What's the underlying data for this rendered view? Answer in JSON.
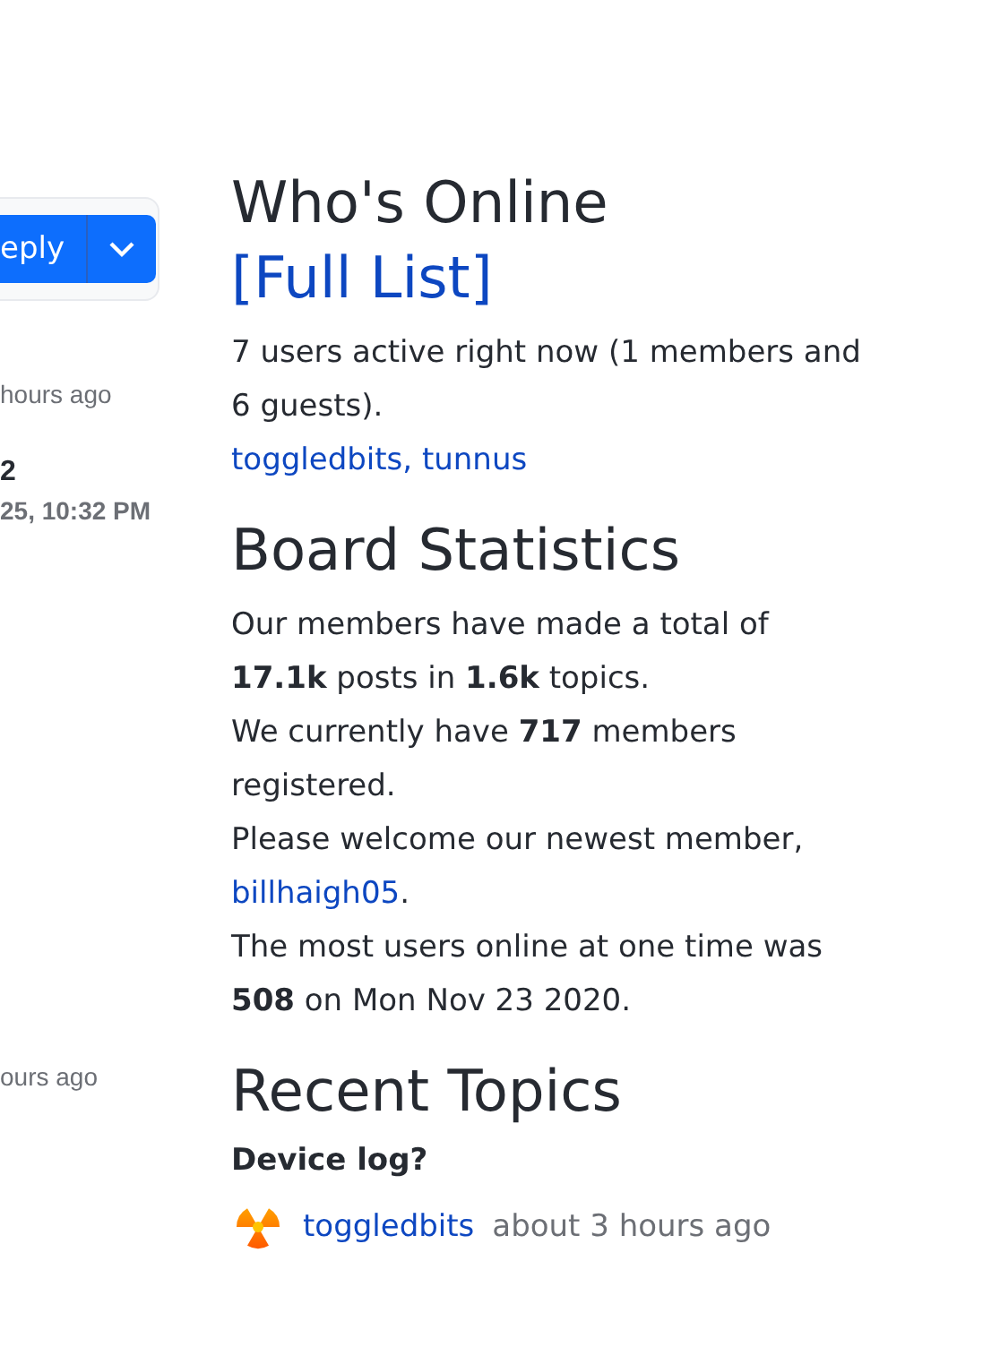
{
  "left_panel": {
    "reply_button": {
      "label": "eply"
    },
    "entries": [
      {
        "kind": "time",
        "text": "hours ago"
      },
      {
        "kind": "title",
        "text": "2"
      },
      {
        "kind": "date",
        "text": "25, 10:32 PM"
      },
      {
        "kind": "time",
        "text": "ours ago"
      }
    ]
  },
  "whos_online": {
    "title": "Who's Online",
    "link": "[Full List]",
    "summary": "7 users active right now (1 members and 6 guests).",
    "users": "toggledbits, tunnus"
  },
  "board_statistics": {
    "title": "Board Statistics",
    "lines": [
      {
        "text": "Our members have made a total of **17.1k** posts in **1.6k** topics."
      },
      {
        "text": "We currently have **717** members registered."
      },
      {
        "text": "Please welcome our newest member, ",
        "link": "billhaigh05",
        "after": "."
      },
      {
        "text": "The most users online at one time was **508** on Mon Nov 23 2020."
      }
    ]
  },
  "recent_topics": {
    "title": "Recent Topics",
    "topics": [
      {
        "title": "Device log?",
        "author": "toggledbits",
        "time": "about 3 hours ago"
      }
    ]
  }
}
